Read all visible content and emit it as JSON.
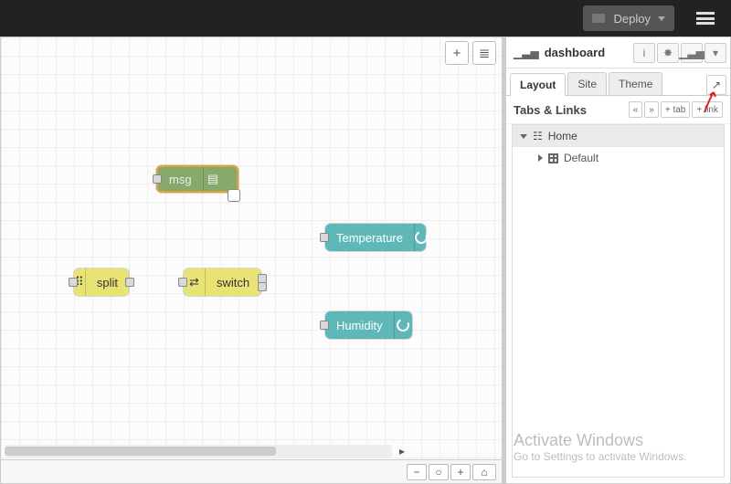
{
  "header": {
    "deploy_label": "Deploy"
  },
  "canvas": {
    "nodes": {
      "debug": {
        "label": "msg"
      },
      "split": {
        "label": "split"
      },
      "switch": {
        "label": "switch"
      },
      "temperature": {
        "label": "Temperature"
      },
      "humidity": {
        "label": "Humidity"
      }
    }
  },
  "sidebar": {
    "title": "dashboard",
    "tabs": [
      {
        "label": "Layout"
      },
      {
        "label": "Site"
      },
      {
        "label": "Theme"
      }
    ],
    "section_title": "Tabs & Links",
    "btn_tab": "+ tab",
    "btn_link": "+ link",
    "collapse": "«",
    "expand": "»",
    "tree": {
      "root": {
        "label": "Home"
      },
      "child": {
        "label": "Default"
      }
    }
  },
  "watermark": {
    "line1": "Activate Windows",
    "line2": "Go to Settings to activate Windows."
  }
}
